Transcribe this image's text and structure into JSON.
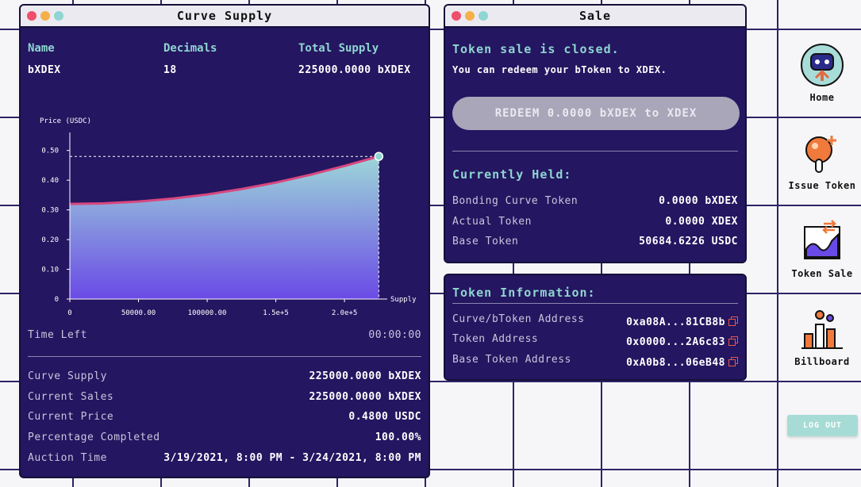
{
  "colors": {
    "panel": "#241660",
    "accent_teal": "#8fd5d1",
    "curve_line": "#d8487f",
    "dot_red": "#ef4e6d",
    "dot_yellow": "#f5b04a",
    "dot_teal": "#8fd5d1",
    "button_disabled": "#a8a6b8",
    "logout": "#a7dcd6",
    "copy_icon": "#e4574a"
  },
  "supply_window": {
    "title": "Curve Supply",
    "headers": {
      "name": "Name",
      "decimals": "Decimals",
      "total_supply": "Total Supply"
    },
    "values": {
      "name": "bXDEX",
      "decimals": "18",
      "total_supply": "225000.0000 bXDEX"
    },
    "time_left_label": "Time Left",
    "time_left_value": "00:00:00",
    "stats": [
      {
        "label": "Curve Supply",
        "value": "225000.0000 bXDEX"
      },
      {
        "label": "Current Sales",
        "value": "225000.0000 bXDEX"
      },
      {
        "label": "Current Price",
        "value": "0.4800 USDC"
      },
      {
        "label": "Percentage Completed",
        "value": "100.00%"
      },
      {
        "label": "Auction Time",
        "value": "3/19/2021, 8:00 PM - 3/24/2021, 8:00 PM"
      }
    ]
  },
  "chart_data": {
    "type": "area",
    "ylabel": "Price (USDC)",
    "xlabel": "Supply",
    "ylim": [
      0,
      0.55
    ],
    "xlim": [
      0,
      230000
    ],
    "y_ticks": [
      {
        "v": 0,
        "label": "0"
      },
      {
        "v": 0.1,
        "label": "0.10"
      },
      {
        "v": 0.2,
        "label": "0.20"
      },
      {
        "v": 0.3,
        "label": "0.30"
      },
      {
        "v": 0.4,
        "label": "0.40"
      },
      {
        "v": 0.5,
        "label": "0.50"
      }
    ],
    "x_ticks": [
      {
        "v": 0,
        "label": "0"
      },
      {
        "v": 50000,
        "label": "50000.00"
      },
      {
        "v": 100000,
        "label": "100000.00"
      },
      {
        "v": 150000,
        "label": "1.5e+5"
      },
      {
        "v": 200000,
        "label": "2.0e+5"
      }
    ],
    "series": [
      {
        "x": [
          0,
          25000,
          50000,
          75000,
          100000,
          125000,
          150000,
          175000,
          200000,
          225000
        ],
        "y": [
          0.32,
          0.322,
          0.328,
          0.338,
          0.352,
          0.37,
          0.392,
          0.418,
          0.448,
          0.48
        ]
      }
    ],
    "current_point": {
      "x": 225000,
      "y": 0.48
    },
    "grid": false
  },
  "sale_window": {
    "title": "Sale",
    "status": "Token sale is closed.",
    "subtitle": "You can redeem your bToken to XDEX.",
    "redeem_label": "REDEEM 0.0000 bXDEX to XDEX",
    "held_title": "Currently Held:",
    "held": [
      {
        "label": "Bonding Curve Token",
        "value": "0.0000 bXDEX"
      },
      {
        "label": "Actual Token",
        "value": "0.0000 XDEX"
      },
      {
        "label": "Base Token",
        "value": "50684.6226 USDC"
      }
    ]
  },
  "info_window": {
    "title": "Token Information:",
    "items": [
      {
        "label": "Curve/bToken Address",
        "value": "0xa08A...81CB8b"
      },
      {
        "label": "Token Address",
        "value": "0x0000...2A6c83"
      },
      {
        "label": "Base Token Address",
        "value": "0xA0b8...06eB48"
      }
    ]
  },
  "sidebar": {
    "items": [
      {
        "label": "Home",
        "icon": "robot-home-icon"
      },
      {
        "label": "Issue Token",
        "icon": "issue-token-icon"
      },
      {
        "label": "Token Sale",
        "icon": "token-sale-icon"
      },
      {
        "label": "Billboard",
        "icon": "billboard-icon"
      }
    ],
    "logout_label": "LOG OUT"
  }
}
